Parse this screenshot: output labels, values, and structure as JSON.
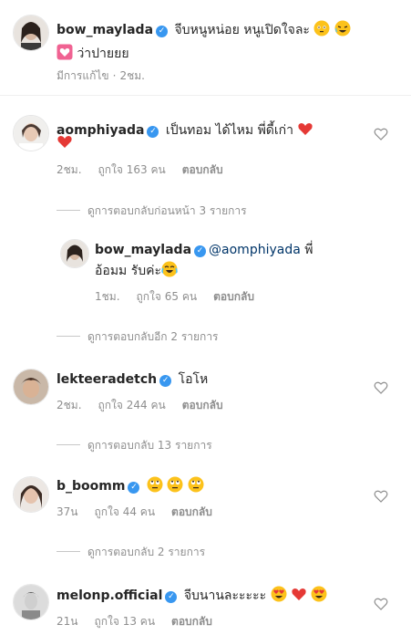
{
  "caption": {
    "username": "bow_maylada",
    "text_line1": " จีบหนูหน่อย หนูเปิดใจละ ",
    "text_line2": " ว่าปายยย",
    "edited": "มีการแก้ไข",
    "time": "2ชม."
  },
  "comments": [
    {
      "username": "aomphiyada",
      "text": " เป็นทอม ได้ไหม พี่ดี้เก่า ",
      "time": "2ชม.",
      "likes": "ถูกใจ 163 คน",
      "reply_label": "ตอบกลับ",
      "view_replies": "ดูการตอบกลับก่อนหน้า 3 รายการ"
    },
    {
      "username": "bow_maylada",
      "mention": "@aomphiyada",
      "text_line1_suffix": " พี่",
      "text_line2": "อ้อมม รับค่ะ",
      "time": "1ชม.",
      "likes": "ถูกใจ 65 คน",
      "reply_label": "ตอบกลับ",
      "view_replies": "ดูการตอบกลับอีก 2 รายการ"
    },
    {
      "username": "lekteeradetch",
      "text": " โอโห",
      "time": "2ชม.",
      "likes": "ถูกใจ 244 คน",
      "reply_label": "ตอบกลับ",
      "view_replies": "ดูการตอบกลับ 13 รายการ"
    },
    {
      "username": "b_boomm",
      "time": "37น",
      "likes": "ถูกใจ 44 คน",
      "reply_label": "ตอบกลับ",
      "view_replies": "ดูการตอบกลับ 2 รายการ"
    },
    {
      "username": "melonp.official",
      "text": " จีบนานละะะะะ",
      "time": "21น",
      "likes": "ถูกใจ 13 คน",
      "reply_label": "ตอบกลับ"
    }
  ],
  "colors": {
    "verified": "#3897f0",
    "meta_text": "#8e8e8e",
    "heart_red": "#ed4956",
    "mention": "#003569"
  },
  "icons": {
    "verified": "verified-badge-icon",
    "like": "heart-outline-icon"
  }
}
